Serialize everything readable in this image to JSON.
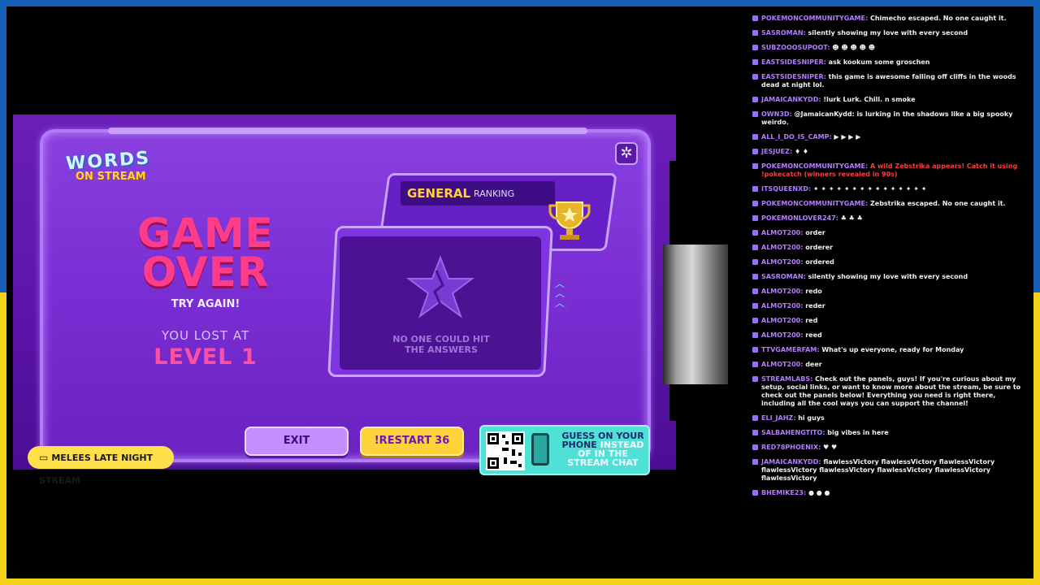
{
  "game": {
    "logo_top": "WORDS",
    "logo_bottom": "ON STREAM",
    "game_over": "GAME OVER",
    "try_again": "TRY AGAIN!",
    "lost_at": "YOU LOST AT",
    "level": "LEVEL 1",
    "ranking_general": "GENERAL",
    "ranking_label": "RANKING",
    "no_one": "NO ONE COULD HIT THE ANSWERS",
    "exit_label": "EXIT",
    "restart_label": "!RESTART",
    "restart_count": "36",
    "guess_1": "GUESS ON YOUR",
    "guess_2": "PHONE",
    "guess_3": "INSTEAD",
    "guess_4": "OF IN THE",
    "guess_5": "STREAM CHAT",
    "stream_tag": "MELEES LATE NIGHT STREAM"
  },
  "chat": [
    {
      "user": "pokemoncommunitygame",
      "text": "Chimecho escaped. No one caught it."
    },
    {
      "user": "SasroMan",
      "text": "silently showing my love with every second"
    },
    {
      "user": "subzooosupoot",
      "text": "☻ ☻ ☻ ☻ ☻"
    },
    {
      "user": "EastsideSniper",
      "text": "ask kookum some groschen"
    },
    {
      "user": "EastsideSniper",
      "text": "this game is awesome falling off cliffs in the woods dead at night lol."
    },
    {
      "user": "JamaicanKydd",
      "text": "!lurk Lurk. Chill. n smoke"
    },
    {
      "user": "OWN3D",
      "text": "@JamaicanKydd: is lurking in the shadows like a big spooky weirdo."
    },
    {
      "user": "all_i_do_is_camp",
      "text": "▶ ▶ ▶ ▶"
    },
    {
      "user": "jesjuez",
      "text": "♦ ♦"
    },
    {
      "user": "pokemoncommunitygame",
      "text": "A wild Zebstrika appears! Catch it using !pokecatch (winners revealed in 90s)",
      "red": true
    },
    {
      "user": "itsqueenxd",
      "text": "✦ ✦ ✦ ✦ ✦ ✦ ✦ ✦ ✦ ✦ ✦ ✦ ✦ ✦ ✦"
    },
    {
      "user": "pokemoncommunitygame",
      "text": "Zebstrika escaped. No one caught it."
    },
    {
      "user": "pokemonlover247",
      "text": "♣ ♣ ♣"
    },
    {
      "user": "almot200",
      "text": "order"
    },
    {
      "user": "almot200",
      "text": "orderer"
    },
    {
      "user": "almot200",
      "text": "ordered"
    },
    {
      "user": "SasroMan",
      "text": "silently showing my love with every second"
    },
    {
      "user": "almot200",
      "text": "redo"
    },
    {
      "user": "almot200",
      "text": "reder"
    },
    {
      "user": "almot200",
      "text": "red"
    },
    {
      "user": "almot200",
      "text": "reed"
    },
    {
      "user": "TTVGamerFam",
      "text": "What's up everyone, ready for Monday"
    },
    {
      "user": "almot200",
      "text": "deer"
    },
    {
      "user": "Streamlabs",
      "text": "Check out the panels, guys! If you're curious about my setup, social links, or want to know more about the stream, be sure to check out the panels below! Everything you need is right there, including all the cool ways you can support the channel!"
    },
    {
      "user": "eli_jahz",
      "text": "hi guys"
    },
    {
      "user": "salbahengtito",
      "text": "big vibes in here"
    },
    {
      "user": "red78phoenix",
      "text": "♥ ♥"
    },
    {
      "user": "JamaicanKydd",
      "text": "flawlessVictory flawlessVictory flawlessVictory flawlessVictory flawlessVictory flawlessVictory flawlessVictory flawlessVictory"
    },
    {
      "user": "bhemike23",
      "text": "● ● ●"
    }
  ]
}
